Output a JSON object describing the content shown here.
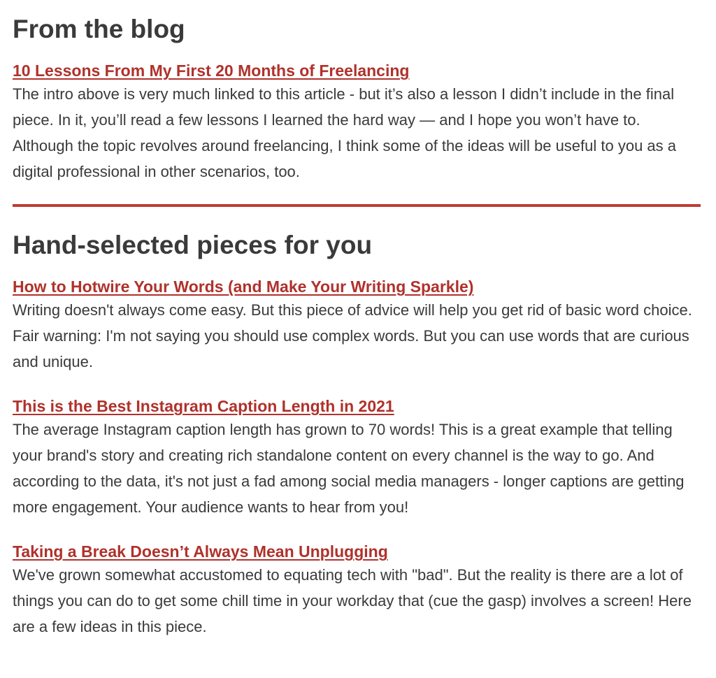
{
  "colors": {
    "accent": "#b0312b",
    "divider": "#bf3b32",
    "text": "#3a3a3a",
    "background": "#ffffff"
  },
  "blog": {
    "heading": "From the blog",
    "article": {
      "title": "10 Lessons From My First 20 Months of Freelancing",
      "description": "The intro above is very much linked to this article - but it’s also a lesson I didn’t include in the final piece. In it, you’ll read a few lessons I learned the hard way — and I hope you won’t have to. Although the topic revolves around freelancing, I think some of the ideas will be useful to you as a digital professional in other scenarios, too."
    }
  },
  "picks": {
    "heading": "Hand-selected pieces for you",
    "articles": [
      {
        "title": "How to Hotwire Your Words (and Make Your Writing Sparkle)",
        "description": "Writing doesn't always come easy. But this piece of advice will help you get rid of basic word choice. Fair warning: I'm not saying you should use complex words. But you can use words that are curious and unique."
      },
      {
        "title": "This is the Best Instagram Caption Length in 2021",
        "description": "The average Instagram caption length has grown to 70 words! This is a great example that telling your brand's story and creating rich standalone content on every channel is the way to go. And according to the data, it's not just a fad among social media managers - longer captions are getting more engagement. Your audience wants to hear from you!"
      },
      {
        "title": "Taking a Break Doesn’t Always Mean Unplugging",
        "description": "We've grown somewhat accustomed to equating tech with \"bad\". But the reality is there are a lot of things you can do to get some chill time in your workday that (cue the gasp) involves a screen! Here are a few ideas in this piece."
      }
    ]
  }
}
